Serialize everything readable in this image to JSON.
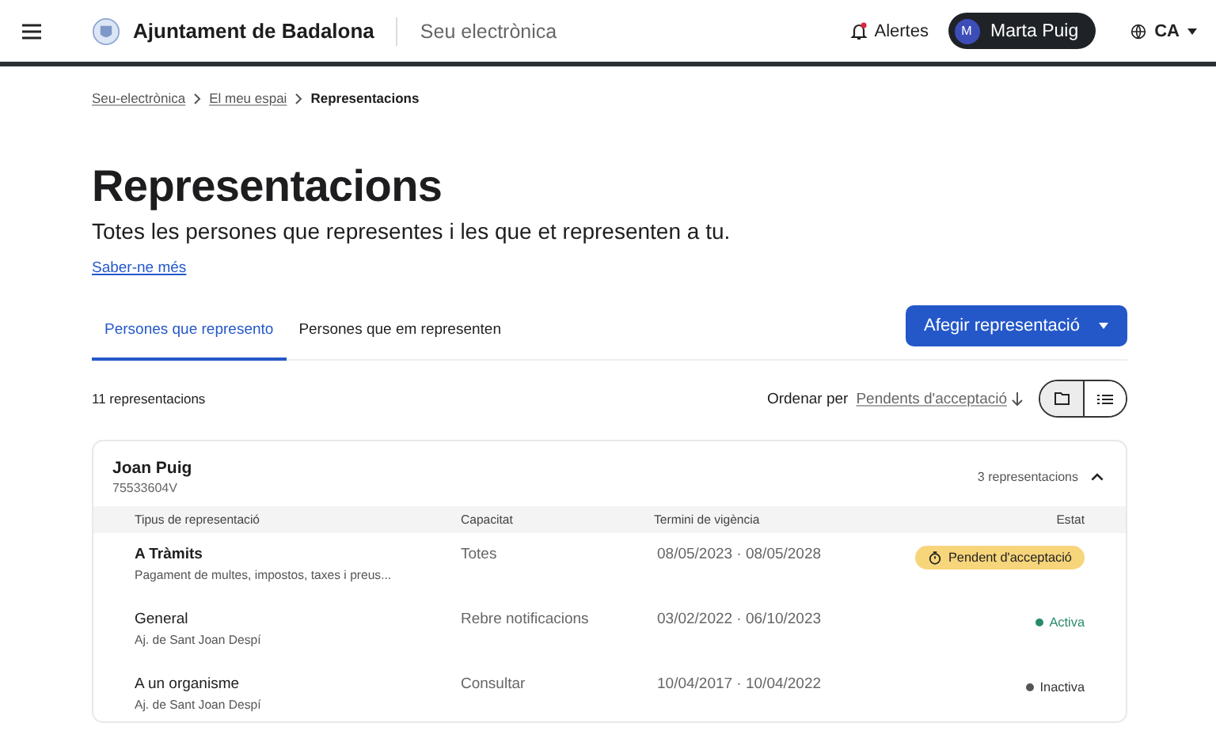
{
  "header": {
    "org_name": "Ajuntament de Badalona",
    "section": "Seu electrònica",
    "alerts": {
      "label": "Alertes",
      "unread": true
    },
    "user": {
      "initial": "M",
      "name": "Marta Puig"
    },
    "language": "CA"
  },
  "breadcrumb": [
    {
      "label": "Seu-electrònica",
      "current": false
    },
    {
      "label": "El meu espai",
      "current": false
    },
    {
      "label": "Representacions",
      "current": true
    }
  ],
  "page": {
    "title": "Representacions",
    "subtitle": "Totes les persones que representes i les que et representen a tu.",
    "link": "Saber-ne més"
  },
  "tabs": [
    {
      "label": "Persones que represento",
      "selected": true
    },
    {
      "label": "Persones que em representen",
      "selected": false
    }
  ],
  "add_button": "Afegir representació",
  "count": "11 representacions",
  "sort": {
    "label": "Ordenar per",
    "value": "Pendents d'acceptació"
  },
  "view_toggle": [
    {
      "kind": "folder",
      "selected": true
    },
    {
      "kind": "list",
      "selected": false
    }
  ],
  "group": {
    "name": "Joan Puig",
    "id": "75533604V",
    "count": "3 representacions",
    "expanded": true,
    "columns": [
      "Tipus de representació",
      "Capacitat",
      "Termini de vigència",
      "Estat"
    ],
    "rows": [
      {
        "type": "A Tràmits",
        "detail": "Pagament de multes, impostos, taxes i preus...",
        "capacity": "Totes",
        "period": "08/05/2023 · 08/05/2028",
        "status": {
          "kind": "pending",
          "label": "Pendent d'acceptació"
        }
      },
      {
        "type": "General",
        "detail": "Aj. de Sant Joan Despí",
        "capacity": "Rebre notificacions",
        "period": "03/02/2022 · 06/10/2023",
        "status": {
          "kind": "active",
          "label": "Activa",
          "color": "#2a8a6e"
        }
      },
      {
        "type": "A un organisme",
        "detail": "Aj. de Sant Joan Despí",
        "capacity": "Consultar",
        "period": "10/04/2017 · 10/04/2022",
        "status": {
          "kind": "inactive",
          "label": "Inactiva",
          "color": "#555555"
        }
      }
    ]
  }
}
